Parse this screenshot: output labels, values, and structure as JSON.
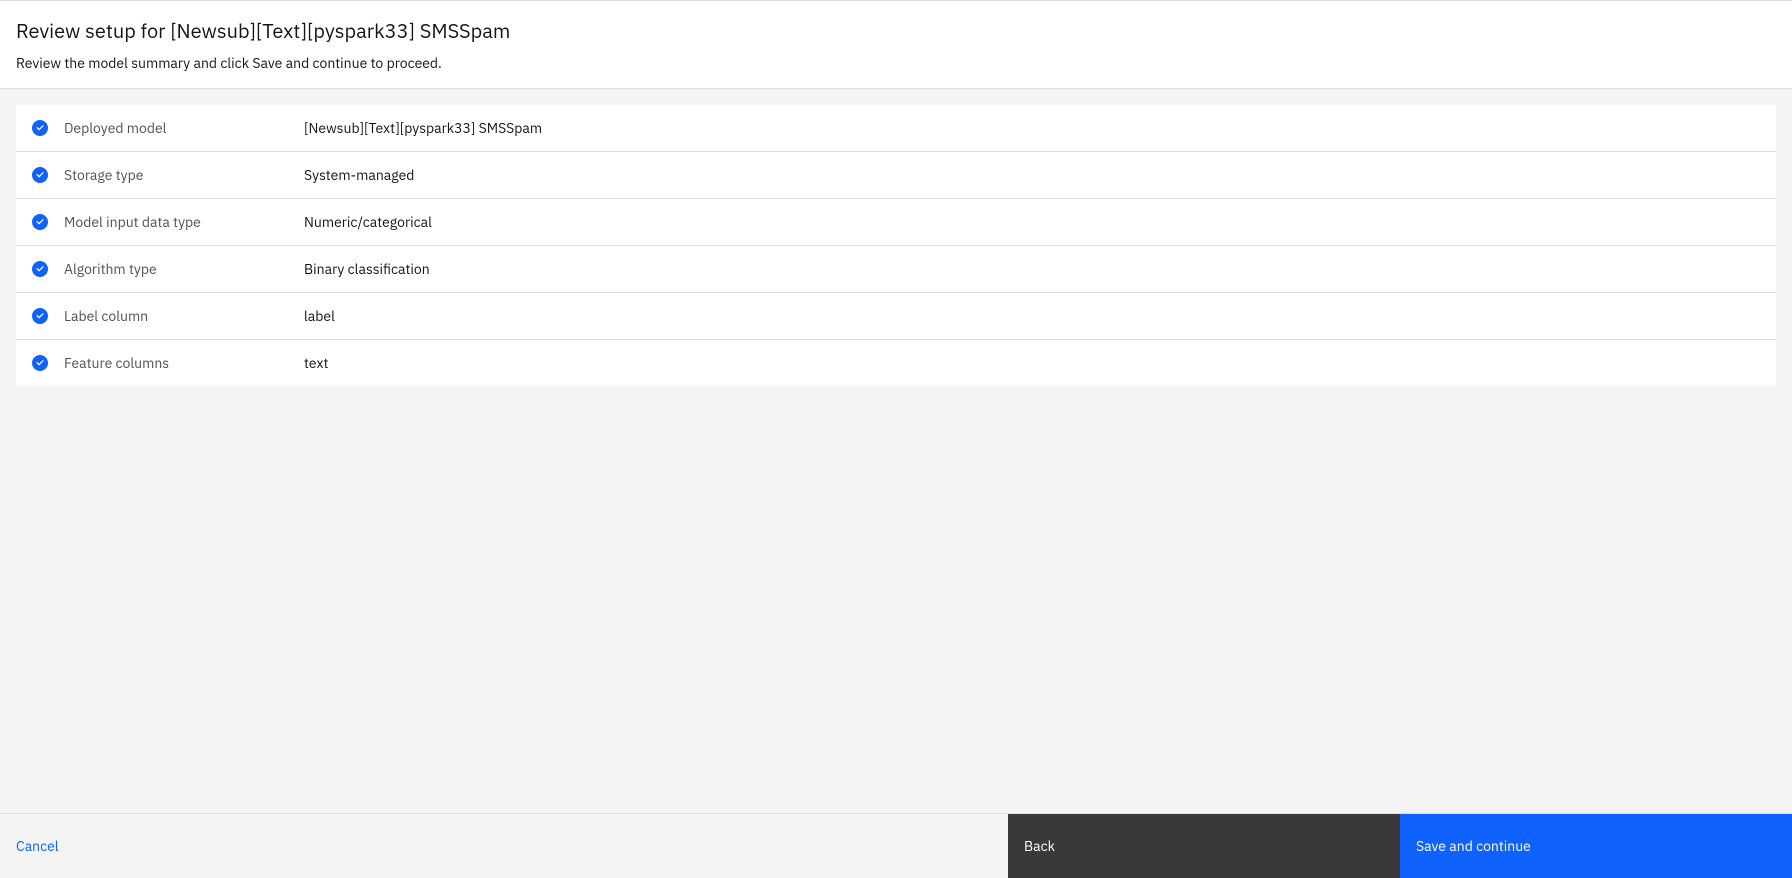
{
  "header": {
    "title": "Review setup for [Newsub][Text][pyspark33] SMSSpam",
    "subtitle": "Review the model summary and click Save and continue to proceed."
  },
  "summary": [
    {
      "label": "Deployed model",
      "value": "[Newsub][Text][pyspark33] SMSSpam"
    },
    {
      "label": "Storage type",
      "value": "System-managed"
    },
    {
      "label": "Model input data type",
      "value": "Numeric/categorical"
    },
    {
      "label": "Algorithm type",
      "value": "Binary classification"
    },
    {
      "label": "Label column",
      "value": "label"
    },
    {
      "label": "Feature columns",
      "value": "text"
    }
  ],
  "footer": {
    "cancel": "Cancel",
    "back": "Back",
    "save": "Save and continue"
  }
}
